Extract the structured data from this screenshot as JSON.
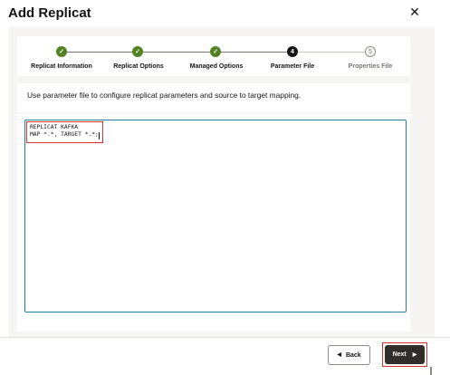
{
  "dialog": {
    "title": "Add Replicat",
    "close_icon": "close-icon",
    "close_glyph": "✕"
  },
  "steps": [
    {
      "label": "Replicat Information",
      "status": "done",
      "glyph": "✓"
    },
    {
      "label": "Replicat Options",
      "status": "done",
      "glyph": "✓"
    },
    {
      "label": "Managed Options",
      "status": "done",
      "glyph": "✓"
    },
    {
      "label": "Parameter File",
      "status": "current",
      "glyph": "4"
    },
    {
      "label": "Properties File",
      "status": "pending",
      "glyph": "5"
    }
  ],
  "description": "Use parameter file to configure replicat parameters and source to target mapping.",
  "editor": {
    "lines": [
      "REPLICAT KAFKA",
      "MAP *.*, TARGET *.*;"
    ]
  },
  "footer": {
    "back_label": "Back",
    "next_label": "Next",
    "back_icon": "caret-left-icon",
    "next_icon": "caret-right-icon",
    "back_glyph": "◀",
    "next_glyph": "▶"
  },
  "colors": {
    "step_done": "#508223",
    "step_current": "#161513",
    "highlight": "#d9342b",
    "editor_border": "#227e9e",
    "primary_button": "#312d2a"
  }
}
